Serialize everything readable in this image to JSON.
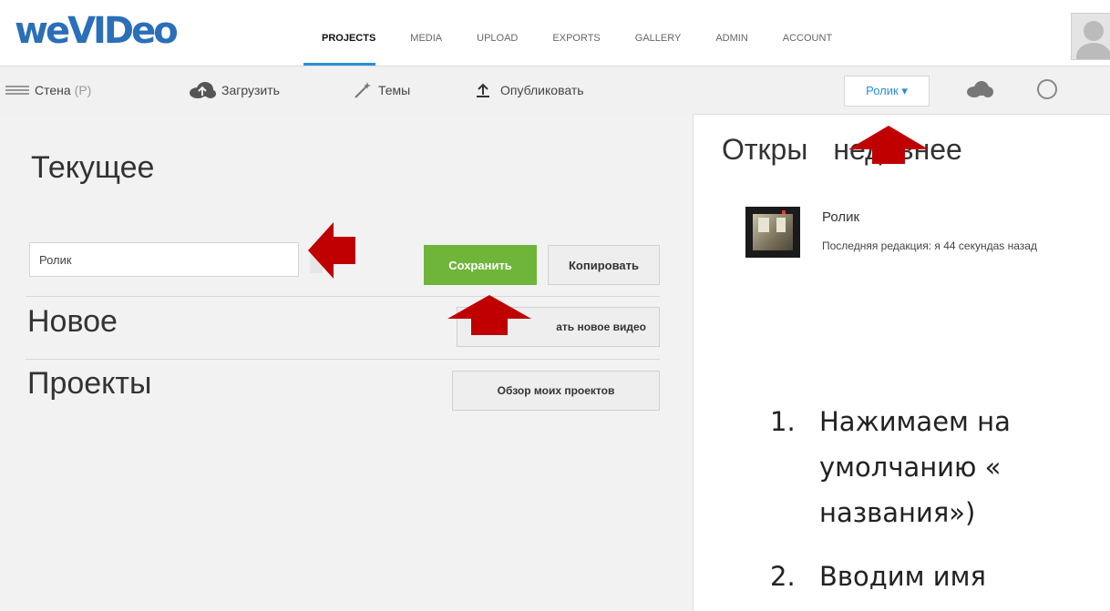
{
  "header": {
    "logo": "weVIDeo",
    "nav": [
      {
        "label": "PROJECTS",
        "active": true
      },
      {
        "label": "MEDIA"
      },
      {
        "label": "UPLOAD"
      },
      {
        "label": "EXPORTS"
      },
      {
        "label": "GALLERY"
      },
      {
        "label": "ADMIN"
      },
      {
        "label": "ACCOUNT"
      }
    ]
  },
  "toolbar": {
    "wall": "Стена",
    "wall_suffix": "(P)",
    "upload": "Загрузить",
    "themes": "Темы",
    "publish": "Опубликовать",
    "project_select": "Ролик ▾"
  },
  "left": {
    "current_title": "Текущее",
    "name_value": "Ролик",
    "save_label": "Сохранить",
    "copy_label": "Копировать",
    "new_title": "Новое",
    "new_video_label": "ать новое видео",
    "projects_title": "Проекты",
    "browse_label": "Обзор моих проектов"
  },
  "right": {
    "recent_title_a": "Откры",
    "recent_title_b": "недавнее",
    "recent_item_title": "Ролик",
    "recent_item_sub": "Последняя редакция: я 44 секундas назад"
  },
  "instructions": {
    "item1_num": "1.",
    "item1_line1": "Нажимаем на",
    "item1_line2": "умолчанию «",
    "item1_line3": "названия»)",
    "item2_num": "2.",
    "item2_line1": "Вводим имя"
  },
  "colors": {
    "accent_blue": "#2a8ed6",
    "save_green": "#6fb53a",
    "arrow_red": "#c00000"
  }
}
